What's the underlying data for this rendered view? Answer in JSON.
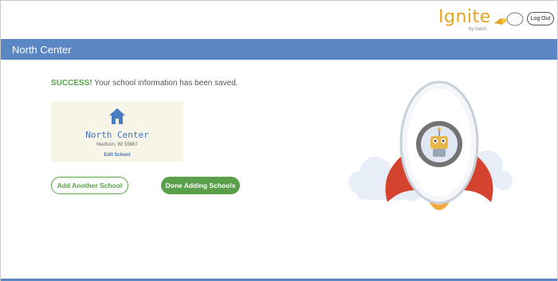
{
  "header": {
    "logo_text": "Ignite",
    "logo_subtext": "by hatch",
    "logout_label": "Log Out"
  },
  "banner": {
    "title": "North Center"
  },
  "message": {
    "prefix": "SUCCESS!",
    "text": " Your school information has been saved."
  },
  "school_card": {
    "name": "North Center",
    "address": "Madison, WI 55667",
    "edit_label": "Edit School"
  },
  "actions": {
    "add_label": "Add Another School",
    "done_label": "Done Adding Schools"
  },
  "colors": {
    "brand_blue": "#5a86c4",
    "success_green": "#58a447",
    "logo_orange": "#e8a323"
  }
}
